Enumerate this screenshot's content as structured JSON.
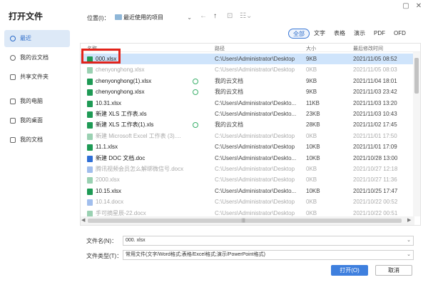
{
  "title": "打开文件",
  "window": {
    "maximize": "▢",
    "close": "✕"
  },
  "location": {
    "label": "位置(I)：",
    "value": "最近使用的项目",
    "caret": "⌄"
  },
  "nav": {
    "back": "←",
    "up": "↑",
    "new_folder": "⊡",
    "view": "☷⌄"
  },
  "sidebar": {
    "items": [
      {
        "label": "最近",
        "icon": "clock-icon"
      },
      {
        "label": "我的云文档",
        "icon": "cloud-icon"
      },
      {
        "label": "共享文件夹",
        "icon": "share-icon"
      },
      {
        "label": "我的电脑",
        "icon": "computer-icon"
      },
      {
        "label": "我的桌面",
        "icon": "desktop-icon"
      },
      {
        "label": "我的文档",
        "icon": "documents-icon"
      }
    ]
  },
  "filters": [
    "全部",
    "文字",
    "表格",
    "演示",
    "PDF",
    "OFD"
  ],
  "columns": {
    "name": "名称",
    "path": "路径",
    "size": "大小",
    "date": "最后修改时间"
  },
  "files": [
    {
      "name": "000.xlsx",
      "path": "C:\\Users\\Administrator\\Desktop",
      "size": "9KB",
      "date": "2021/11/05 08:52",
      "type": "xls",
      "dim": false,
      "sync": false
    },
    {
      "name": "chenyonghong.xlsx",
      "path": "C:\\Users\\Administrator\\Desktop",
      "size": "0KB",
      "date": "2021/11/05 08:03",
      "type": "xls",
      "dim": true,
      "sync": false
    },
    {
      "name": "chenyonghong(1).xlsx",
      "path": "我的云文档",
      "size": "9KB",
      "date": "2021/11/04 18:01",
      "type": "xls",
      "dim": false,
      "sync": true
    },
    {
      "name": "chenyonghong.xlsx",
      "path": "我的云文档",
      "size": "9KB",
      "date": "2021/11/03 23:42",
      "type": "xls",
      "dim": false,
      "sync": true
    },
    {
      "name": "10.31.xlsx",
      "path": "C:\\Users\\Administrator\\Deskto...",
      "size": "11KB",
      "date": "2021/11/03 13:20",
      "type": "xls",
      "dim": false,
      "sync": false
    },
    {
      "name": "新建 XLS 工作表.xls",
      "path": "C:\\Users\\Administrator\\Deskto...",
      "size": "23KB",
      "date": "2021/11/03 10:43",
      "type": "xls",
      "dim": false,
      "sync": false
    },
    {
      "name": "新建 XLS 工作表(1).xls",
      "path": "我的云文档",
      "size": "28KB",
      "date": "2021/11/02 17:45",
      "type": "xls",
      "dim": false,
      "sync": true
    },
    {
      "name": "新建 Microsoft Excel 工作表 (3)....",
      "path": "C:\\Users\\Administrator\\Desktop",
      "size": "0KB",
      "date": "2021/11/01 17:50",
      "type": "xls",
      "dim": true,
      "sync": false
    },
    {
      "name": "11.1.xlsx",
      "path": "C:\\Users\\Administrator\\Desktop",
      "size": "10KB",
      "date": "2021/11/01 17:09",
      "type": "xls",
      "dim": false,
      "sync": false
    },
    {
      "name": "新建 DOC 文档.doc",
      "path": "C:\\Users\\Administrator\\Deskto...",
      "size": "10KB",
      "date": "2021/10/28 13:00",
      "type": "doc",
      "dim": false,
      "sync": false
    },
    {
      "name": "腾讯视频会员怎么解绑微信号.docx",
      "path": "C:\\Users\\Administrator\\Desktop",
      "size": "0KB",
      "date": "2021/10/27 12:18",
      "type": "doc",
      "dim": true,
      "sync": false
    },
    {
      "name": "2000.xlsx",
      "path": "C:\\Users\\Administrator\\Desktop",
      "size": "0KB",
      "date": "2021/10/27 11:36",
      "type": "xls",
      "dim": true,
      "sync": false
    },
    {
      "name": "10.15.xlsx",
      "path": "C:\\Users\\Administrator\\Deskto...",
      "size": "10KB",
      "date": "2021/10/25 17:47",
      "type": "xls",
      "dim": false,
      "sync": false
    },
    {
      "name": "10.14.docx",
      "path": "C:\\Users\\Administrator\\Desktop",
      "size": "0KB",
      "date": "2021/10/22 00:52",
      "type": "doc",
      "dim": true,
      "sync": false
    },
    {
      "name": "手可摘星辰-22.docx",
      "path": "C:\\Users\\Administrator\\Desktop",
      "size": "0KB",
      "date": "2021/10/22 00:51",
      "type": "xls",
      "dim": true,
      "sync": false
    }
  ],
  "hscroll": {
    "left": "◀",
    "right": "▶",
    "grip": "|||"
  },
  "filename": {
    "label": "文件名(N)：",
    "value": "000. xlsx",
    "caret": "⌄"
  },
  "filetype": {
    "label": "文件类型(T)：",
    "value": "常用文件(文字/Word格式;表格/Excel格式;演示/PowerPoint格式)",
    "caret": "⌄"
  },
  "buttons": {
    "open": "打开(O)",
    "cancel": "取消"
  },
  "colors": {
    "accent": "#3e7fde",
    "highlight": "#e2231a",
    "selected_row": "#cfe4fb",
    "xls": "#1e9a55",
    "doc": "#2f6fd6"
  }
}
